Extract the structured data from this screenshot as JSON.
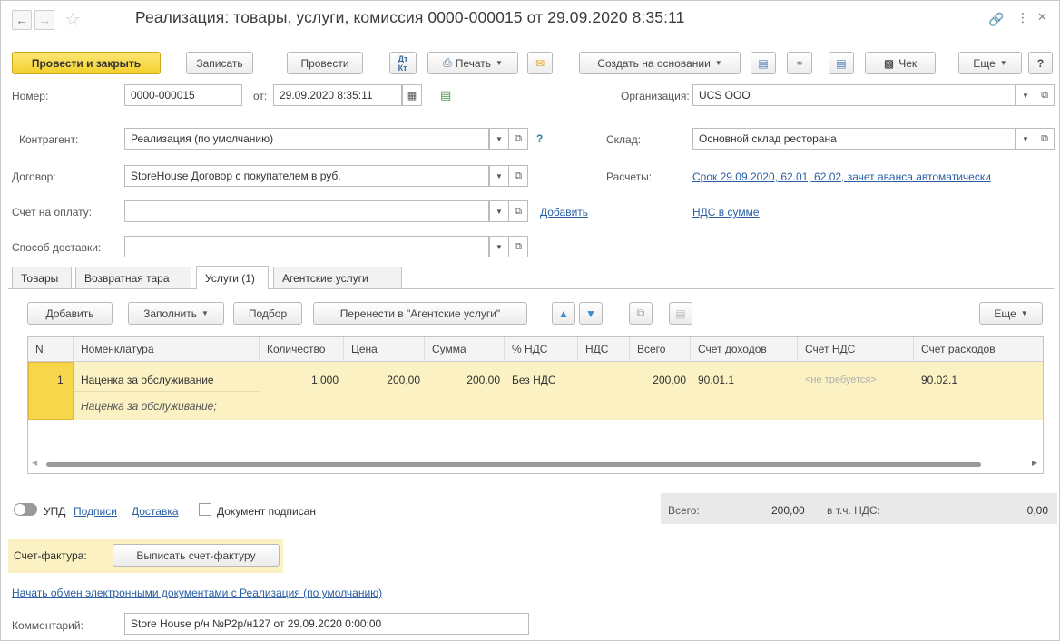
{
  "window": {
    "title": "Реализация: товары, услуги, комиссия 0000-000015 от 29.09.2020 8:35:11"
  },
  "icons": {
    "back": "arrow-left-icon",
    "forward": "arrow-right-icon",
    "favorite": "star-icon",
    "link": "link-icon",
    "more": "more-vertical-icon",
    "close": "close-icon"
  },
  "toolbar": {
    "post_close": "Провести и закрыть",
    "save": "Записать",
    "post": "Провести",
    "print": "Печать",
    "create_based": "Создать на основании",
    "receipt": "Чек",
    "more": "Еще",
    "help": "?"
  },
  "form": {
    "number_label": "Номер:",
    "number_value": "0000-000015",
    "from_label": "от:",
    "date_value": "29.09.2020  8:35:11",
    "org_label": "Организация:",
    "org_value": "UCS OOO",
    "contractor_label": "Контрагент:",
    "contractor_value": "Реализация (по умолчанию)",
    "question": "?",
    "warehouse_label": "Склад:",
    "warehouse_value": "Основной склад ресторана",
    "contract_label": "Договор:",
    "contract_value": "StoreHouse Договор с покупателем в руб.",
    "settlements_label": "Расчеты:",
    "settlements_link": "Срок 29.09.2020, 62.01, 62.02, зачет аванса автоматически",
    "invoice_label": "Счет на оплату:",
    "invoice_value": "",
    "add_link": "Добавить",
    "vat_link": "НДС в сумме",
    "delivery_label": "Способ доставки:",
    "delivery_value": ""
  },
  "tabs": [
    {
      "label": "Товары"
    },
    {
      "label": "Возвратная тара"
    },
    {
      "label": "Услуги (1)"
    },
    {
      "label": "Агентские услуги"
    }
  ],
  "table_toolbar": {
    "add": "Добавить",
    "fill": "Заполнить",
    "select": "Подбор",
    "move": "Перенести в \"Агентские услуги\"",
    "more": "Еще"
  },
  "table": {
    "columns": [
      "N",
      "Номенклатура",
      "Количество",
      "Цена",
      "Сумма",
      "% НДС",
      "НДС",
      "Всего",
      "Счет доходов",
      "Счет НДС",
      "Счет расходов"
    ],
    "rows": [
      {
        "n": "1",
        "name": "Наценка за обслуживание",
        "name_sub": "Наценка за обслуживание;",
        "qty": "1,000",
        "price": "200,00",
        "sum": "200,00",
        "vat_rate": "Без НДС",
        "vat": "",
        "total": "200,00",
        "income_acc": "90.01.1",
        "vat_acc": "<не требуется>",
        "expense_acc": "90.02.1"
      }
    ]
  },
  "footer": {
    "upd": "УПД",
    "signatures": "Подписи",
    "delivery": "Доставка",
    "signed": "Документ подписан",
    "total_label": "Всего:",
    "total_value": "200,00",
    "vat_incl_label": "в т.ч. НДС:",
    "vat_incl_value": "0,00",
    "sf_label": "Счет-фактура:",
    "sf_button": "Выписать счет-фактуру",
    "edo_link": "Начать обмен электронными документами с Реализация (по умолчанию)",
    "comment_label": "Комментарий:",
    "comment_value": "Store House р/н №P2р/н127 от 29.09.2020 0:00:00"
  },
  "colors": {
    "primary_button": "#f3cf2c",
    "selected_row": "#fbf1c3",
    "link": "#2a5fa5"
  }
}
